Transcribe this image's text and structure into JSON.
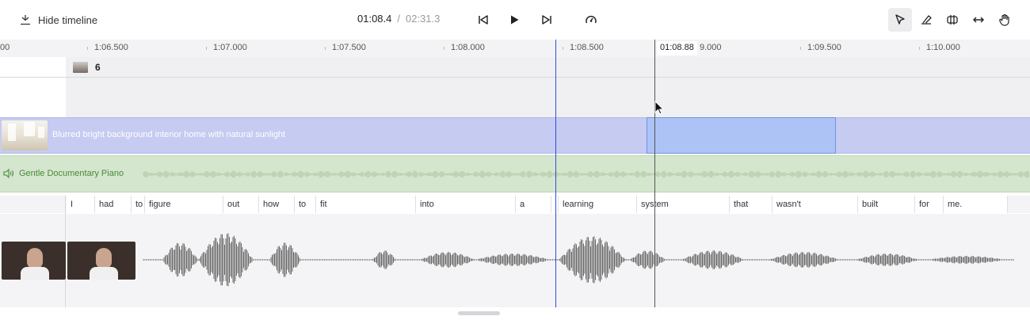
{
  "toolbar": {
    "hide_timeline_label": "Hide timeline",
    "current_time": "01:08.4",
    "separator": "/",
    "total_time": "02:31.3",
    "active_tool": "pointer-tool"
  },
  "ruler": {
    "ticks": [
      "00",
      "1:06.500",
      "1:07.000",
      "1:07.500",
      "1:08.000",
      "1:08.500",
      "9.000",
      "1:09.500",
      "1:10.000"
    ],
    "cursor_time": "01:08.88"
  },
  "scene": {
    "number": "6"
  },
  "video_track": {
    "label": "Blurred bright background interior home with natural sunlight"
  },
  "audio_track": {
    "label": "Gentle Documentary Piano"
  },
  "words": [
    "I",
    "had",
    "to",
    "figure",
    "out",
    "how",
    "to",
    "fit",
    "into",
    "a",
    "",
    "learning",
    "system",
    "that",
    "wasn't",
    "built",
    "for",
    "me."
  ],
  "colors": {
    "video_track": "#c5cbf1",
    "video_selection": "#aec3f5",
    "audio_track": "#d4e6cd",
    "playhead": "#2d4fd8"
  },
  "icons": [
    "hide-timeline-icon",
    "skip-back-icon",
    "play-icon",
    "skip-forward-icon",
    "speed-icon",
    "pointer-tool-icon",
    "eraser-tool-icon",
    "trim-tool-icon",
    "stretch-tool-icon",
    "hand-tool-icon",
    "speaker-icon"
  ]
}
